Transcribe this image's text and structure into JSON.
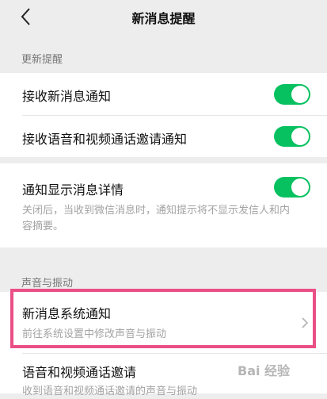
{
  "header": {
    "title": "新消息提醒"
  },
  "sections": {
    "update": {
      "heading": "更新提醒",
      "items": [
        {
          "label": "接收新消息通知",
          "on": true
        },
        {
          "label": "接收语音和视频通话邀请通知",
          "on": true
        }
      ]
    },
    "detail": {
      "label": "通知显示消息详情",
      "on": true,
      "desc_line1": "关闭后，当收到微信消息时，通知提示将不显示发信人和内",
      "desc_line2": "容摘要。"
    },
    "sound": {
      "heading": "声音与振动",
      "items": [
        {
          "label": "新消息系统通知",
          "desc": "前往系统设置中修改声音与振动"
        },
        {
          "label": "语音和视频通话邀请",
          "desc": "收到语音和视频通话邀请的声音与振动"
        }
      ]
    }
  },
  "watermark": {
    "text": "Bai 经验"
  },
  "colors": {
    "toggle_on": "#07c160",
    "highlight": "#ea4f86",
    "background": "#ededed"
  }
}
